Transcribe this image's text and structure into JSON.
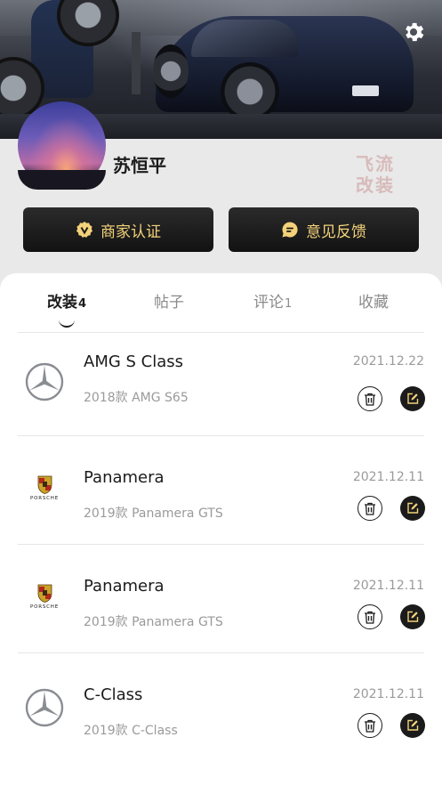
{
  "profile": {
    "username": "苏恒平",
    "watermark_line1": "飞流",
    "watermark_line2": "改装"
  },
  "actions": {
    "merchant_label": "商家认证",
    "feedback_label": "意见反馈"
  },
  "tabs": [
    {
      "label": "改装",
      "count": "4",
      "active": true
    },
    {
      "label": "帖子",
      "count": "",
      "active": false
    },
    {
      "label": "评论",
      "count": "1",
      "active": false
    },
    {
      "label": "收藏",
      "count": "",
      "active": false
    }
  ],
  "items": [
    {
      "brand": "mercedes-logo-icon",
      "name": "AMG S Class",
      "sub": "2018款 AMG S65",
      "date": "2021.12.22"
    },
    {
      "brand": "porsche-logo-icon",
      "brand_text": "PORSCHE",
      "name": "Panamera",
      "sub": "2019款 Panamera GTS",
      "date": "2021.12.11"
    },
    {
      "brand": "porsche-logo-icon",
      "brand_text": "PORSCHE",
      "name": "Panamera",
      "sub": "2019款 Panamera GTS",
      "date": "2021.12.11"
    },
    {
      "brand": "mercedes-logo-icon",
      "name": "C-Class",
      "sub": "2019款 C-Class",
      "date": "2021.12.11"
    }
  ],
  "colors": {
    "accent_gold": "#f3d27a",
    "button_dark": "#1b1b1b"
  }
}
